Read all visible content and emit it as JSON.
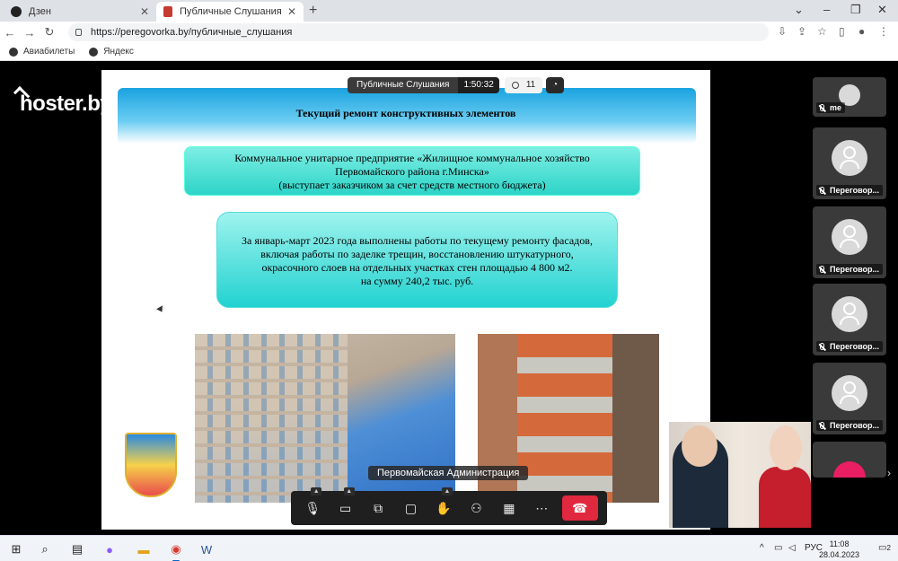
{
  "browser": {
    "tabs": [
      {
        "label": "Дзен",
        "active": false
      },
      {
        "label": "Публичные Слушания | Peregov",
        "active": true
      }
    ],
    "url": "https://peregovorka.by/публичные_слушания",
    "bookmarks": [
      "Авиабилеты",
      "Яндекс"
    ]
  },
  "conference": {
    "brand": "hoster.by",
    "title": "Публичные Слушания",
    "timer": "1:50:32",
    "participants_count": "11",
    "current_speaker": "Первомайская Администрация",
    "participants": [
      {
        "name": "me"
      },
      {
        "name": "Переговор..."
      },
      {
        "name": "Переговор..."
      },
      {
        "name": "Переговор..."
      },
      {
        "name": "Переговор..."
      }
    ]
  },
  "slide": {
    "title": "Текущий ремонт конструктивных элементов",
    "box1_lines": [
      "Коммунальное унитарное предприятие «Жилищное коммунальное хозяйство",
      "Первомайского района г.Минска»",
      "(выступает заказчиком за счет средств местного бюджета)"
    ],
    "box2_lines": [
      "За январь-март 2023 года выполнены работы по текущему ремонту фасадов,",
      "включая работы по заделке трещин, восстановлению штукатурного,",
      "окрасочного слоев на отдельных участках стен площадью 4 800 м2.",
      "на сумму 240,2 тыс. руб."
    ]
  },
  "taskbar": {
    "lang": "РУС",
    "time": "11:08",
    "date": "28.04.2023",
    "notifications": "2"
  },
  "colors": {
    "hangup": "#e0283e",
    "slide_header": "#1aa3e0",
    "box": "#2dd4c8"
  }
}
